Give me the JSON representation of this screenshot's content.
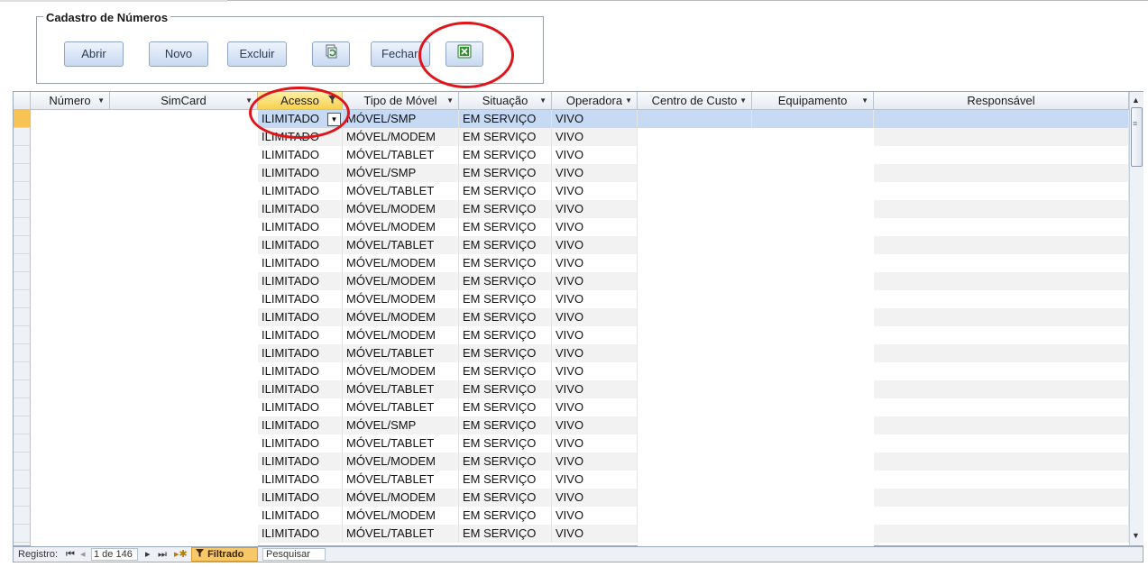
{
  "form": {
    "group_title": "Cadastro de Números",
    "buttons": {
      "abrir": "Abrir",
      "novo": "Novo",
      "excluir": "Excluir",
      "fechar": "Fechar"
    },
    "icons": {
      "refresh": "refresh-document-icon",
      "excel": "excel-icon"
    }
  },
  "table": {
    "columns": [
      {
        "key": "numero",
        "label": "Número"
      },
      {
        "key": "simcard",
        "label": "SimCard"
      },
      {
        "key": "acesso",
        "label": "Acesso"
      },
      {
        "key": "tipo",
        "label": "Tipo de Móvel"
      },
      {
        "key": "situacao",
        "label": "Situação"
      },
      {
        "key": "operadora",
        "label": "Operadora"
      },
      {
        "key": "centro",
        "label": "Centro de Custo"
      },
      {
        "key": "equipamento",
        "label": "Equipamento"
      },
      {
        "key": "responsavel",
        "label": "Responsável"
      }
    ],
    "rows": [
      {
        "acesso": "ILIMITADO",
        "tipo": "MÓVEL/SMP",
        "situacao": "EM SERVIÇO",
        "operadora": "VIVO"
      },
      {
        "acesso": "ILIMITADO",
        "tipo": "MÓVEL/MODEM",
        "situacao": "EM SERVIÇO",
        "operadora": "VIVO"
      },
      {
        "acesso": "ILIMITADO",
        "tipo": "MÓVEL/TABLET",
        "situacao": "EM SERVIÇO",
        "operadora": "VIVO"
      },
      {
        "acesso": "ILIMITADO",
        "tipo": "MÓVEL/SMP",
        "situacao": "EM SERVIÇO",
        "operadora": "VIVO"
      },
      {
        "acesso": "ILIMITADO",
        "tipo": "MÓVEL/TABLET",
        "situacao": "EM SERVIÇO",
        "operadora": "VIVO"
      },
      {
        "acesso": "ILIMITADO",
        "tipo": "MÓVEL/MODEM",
        "situacao": "EM SERVIÇO",
        "operadora": "VIVO"
      },
      {
        "acesso": "ILIMITADO",
        "tipo": "MÓVEL/MODEM",
        "situacao": "EM SERVIÇO",
        "operadora": "VIVO"
      },
      {
        "acesso": "ILIMITADO",
        "tipo": "MÓVEL/TABLET",
        "situacao": "EM SERVIÇO",
        "operadora": "VIVO"
      },
      {
        "acesso": "ILIMITADO",
        "tipo": "MÓVEL/MODEM",
        "situacao": "EM SERVIÇO",
        "operadora": "VIVO"
      },
      {
        "acesso": "ILIMITADO",
        "tipo": "MÓVEL/MODEM",
        "situacao": "EM SERVIÇO",
        "operadora": "VIVO"
      },
      {
        "acesso": "ILIMITADO",
        "tipo": "MÓVEL/MODEM",
        "situacao": "EM SERVIÇO",
        "operadora": "VIVO"
      },
      {
        "acesso": "ILIMITADO",
        "tipo": "MÓVEL/MODEM",
        "situacao": "EM SERVIÇO",
        "operadora": "VIVO"
      },
      {
        "acesso": "ILIMITADO",
        "tipo": "MÓVEL/MODEM",
        "situacao": "EM SERVIÇO",
        "operadora": "VIVO"
      },
      {
        "acesso": "ILIMITADO",
        "tipo": "MÓVEL/TABLET",
        "situacao": "EM SERVIÇO",
        "operadora": "VIVO"
      },
      {
        "acesso": "ILIMITADO",
        "tipo": "MÓVEL/MODEM",
        "situacao": "EM SERVIÇO",
        "operadora": "VIVO"
      },
      {
        "acesso": "ILIMITADO",
        "tipo": "MÓVEL/TABLET",
        "situacao": "EM SERVIÇO",
        "operadora": "VIVO"
      },
      {
        "acesso": "ILIMITADO",
        "tipo": "MÓVEL/TABLET",
        "situacao": "EM SERVIÇO",
        "operadora": "VIVO"
      },
      {
        "acesso": "ILIMITADO",
        "tipo": "MÓVEL/SMP",
        "situacao": "EM SERVIÇO",
        "operadora": "VIVO"
      },
      {
        "acesso": "ILIMITADO",
        "tipo": "MÓVEL/TABLET",
        "situacao": "EM SERVIÇO",
        "operadora": "VIVO"
      },
      {
        "acesso": "ILIMITADO",
        "tipo": "MÓVEL/MODEM",
        "situacao": "EM SERVIÇO",
        "operadora": "VIVO"
      },
      {
        "acesso": "ILIMITADO",
        "tipo": "MÓVEL/TABLET",
        "situacao": "EM SERVIÇO",
        "operadora": "VIVO"
      },
      {
        "acesso": "ILIMITADO",
        "tipo": "MÓVEL/MODEM",
        "situacao": "EM SERVIÇO",
        "operadora": "VIVO"
      },
      {
        "acesso": "ILIMITADO",
        "tipo": "MÓVEL/MODEM",
        "situacao": "EM SERVIÇO",
        "operadora": "VIVO"
      },
      {
        "acesso": "ILIMITADO",
        "tipo": "MÓVEL/TABLET",
        "situacao": "EM SERVIÇO",
        "operadora": "VIVO"
      }
    ]
  },
  "navigation": {
    "registro_label": "Registro:",
    "record_position": "1 de 146",
    "filter_label": "Filtrado",
    "search_label": "Pesquisar"
  },
  "colors": {
    "selected_row": "#c6daf4",
    "filtered_header": "#f6d14e",
    "annotation_red": "#e0141b"
  }
}
